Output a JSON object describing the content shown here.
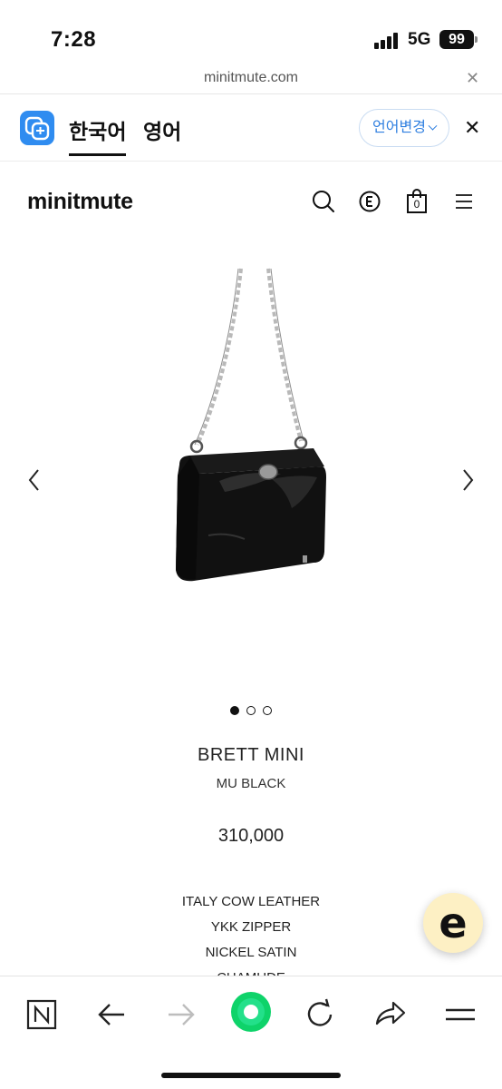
{
  "status_bar": {
    "time": "7:28",
    "network": "5G",
    "battery": "99"
  },
  "url_bar": {
    "url": "minitmute.com",
    "close_icon": "close-icon"
  },
  "translate_bar": {
    "logo_icon": "papago-translate-icon",
    "tab_korean": "한국어",
    "tab_english": "영어",
    "change_language": "언어변경",
    "accent": "#2f8cf0"
  },
  "site_header": {
    "brand": "minitmute",
    "icons": [
      "search-icon",
      "e-circle-icon",
      "shopping-bag-icon",
      "menu-icon"
    ],
    "cart_count": "0"
  },
  "product": {
    "image_icon": "black-leather-chain-bag-image",
    "carousel_dots": 3,
    "active_dot": 1,
    "name": "BRETT MINI",
    "color": "MU BLACK",
    "price": "310,000",
    "features": [
      "ITALY COW LEATHER",
      "YKK ZIPPER",
      "NICKEL SATIN",
      "CHAMUDE"
    ]
  },
  "floating_button": {
    "label": "e",
    "background": "#fdf0c4"
  },
  "toolbar": {
    "buttons": [
      "naver-n-icon",
      "back-arrow-icon",
      "forward-arrow-icon",
      "green-home-icon",
      "refresh-icon",
      "share-icon",
      "menu-icon"
    ]
  }
}
